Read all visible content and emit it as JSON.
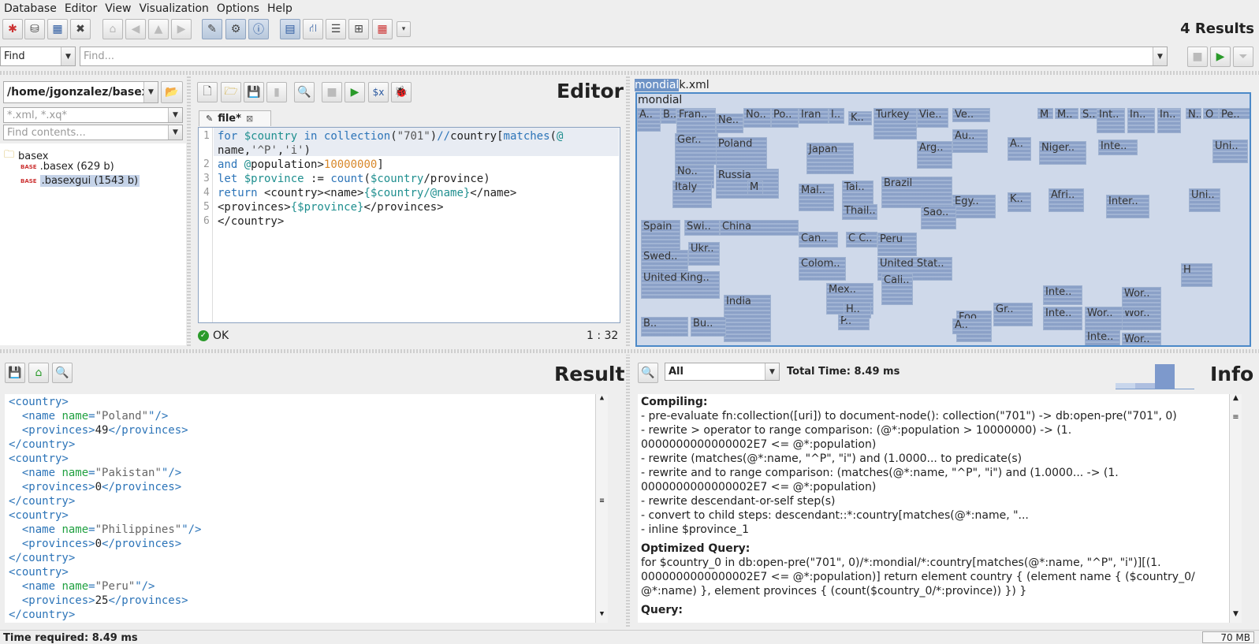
{
  "menu": [
    "Database",
    "Editor",
    "View",
    "Visualization",
    "Options",
    "Help"
  ],
  "toolbar": {
    "results": "4 Results"
  },
  "find": {
    "mode": "Find",
    "placeholder": "Find..."
  },
  "project": {
    "path": "/home/jgonzalez/basex",
    "filter_placeholder": "*.xml, *.xq*",
    "contents_placeholder": "Find contents...",
    "folder": "basex",
    "files": [
      {
        "name": ".basex (629 b)"
      },
      {
        "name": ".basexgui (1543 b)"
      }
    ]
  },
  "editor": {
    "title": "Editor",
    "tab": "file*",
    "status": "OK",
    "position": "1 : 32",
    "lines": [
      "1",
      "2",
      "3",
      "4",
      "5",
      "6"
    ]
  },
  "map": {
    "breadcrumb_db": "mondial",
    "breadcrumb_file": "k.xml",
    "root": "mondial",
    "labels": [
      "A..",
      "B..",
      "Fran..",
      "Ne..",
      "No..",
      "Po..",
      "Iran",
      "I..",
      "K..",
      "Turkey",
      "Vie..",
      "Ve..",
      "M",
      "M..",
      "S..",
      "Int..",
      "In..",
      "In..",
      "N..",
      "O",
      "Pe..",
      "Ger..",
      "Poland",
      "Japan",
      "Arg..",
      "Au..",
      "A..",
      "Niger..",
      "Inte..",
      "Uni..",
      "Russia",
      "No..",
      "Italy",
      "M",
      "Mal..",
      "Tai..",
      "Brazil",
      "Egy..",
      "K..",
      "Afri..",
      "Inter..",
      "Uni..",
      "Spain",
      "Swi..",
      "China",
      "Can..",
      "C C..",
      "Peru",
      "United Stat..",
      "Colom..",
      "Cali..",
      "Sao..",
      "Swed..",
      "Ukr..",
      "United King..",
      "India",
      "Mex..",
      "Foo..",
      "Gr..",
      "Inte..",
      "Wor..",
      "Wor..",
      "Wor..",
      "Wor..",
      "Thail..",
      "Inte..",
      "Inte..",
      "H",
      "B..",
      "Bu..",
      "P..",
      "A..",
      "H.."
    ]
  },
  "result": {
    "title": "Result"
  },
  "info": {
    "title": "Info",
    "filter": "All",
    "total_time": "Total Time: 8.49 ms",
    "compiling_header": "Compiling:",
    "compiling": [
      "- pre-evaluate fn:collection([uri]) to document-node(): collection(\"701\") -> db:open-pre(\"701\", 0)",
      "- rewrite > operator to range comparison: (@*:population > 10000000) -> (1.",
      "0000000000000002E7 <= @*:population)",
      "- rewrite (matches(@*:name, \"^P\", \"i\") and (1.0000... to predicate(s)",
      "- rewrite and to range comparison: (matches(@*:name, \"^P\", \"i\") and (1.0000... -> (1.",
      "0000000000000002E7 <= @*:population)",
      "- rewrite descendant-or-self step(s)",
      "- convert to child steps: descendant::*:country[matches(@*:name, \"...",
      "- inline $province_1"
    ],
    "optimized_header": "Optimized Query:",
    "optimized": [
      "for $country_0 in db:open-pre(\"701\", 0)/*:mondial/*:country[matches(@*:name, \"^P\", \"i\")][(1.",
      "0000000000000002E7 <= @*:population)] return element country { (element name { ($country_0/",
      "@*:name) }, element provinces { (count($country_0/*:province)) }) }"
    ],
    "query_header": "Query:"
  },
  "status": {
    "time": "Time required: 8.49 ms",
    "memory": "70 MB"
  },
  "results": [
    {
      "name": "Poland",
      "provinces": "49"
    },
    {
      "name": "Pakistan",
      "provinces": "0"
    },
    {
      "name": "Philippines",
      "provinces": "0"
    },
    {
      "name": "Peru",
      "provinces": "25"
    }
  ]
}
